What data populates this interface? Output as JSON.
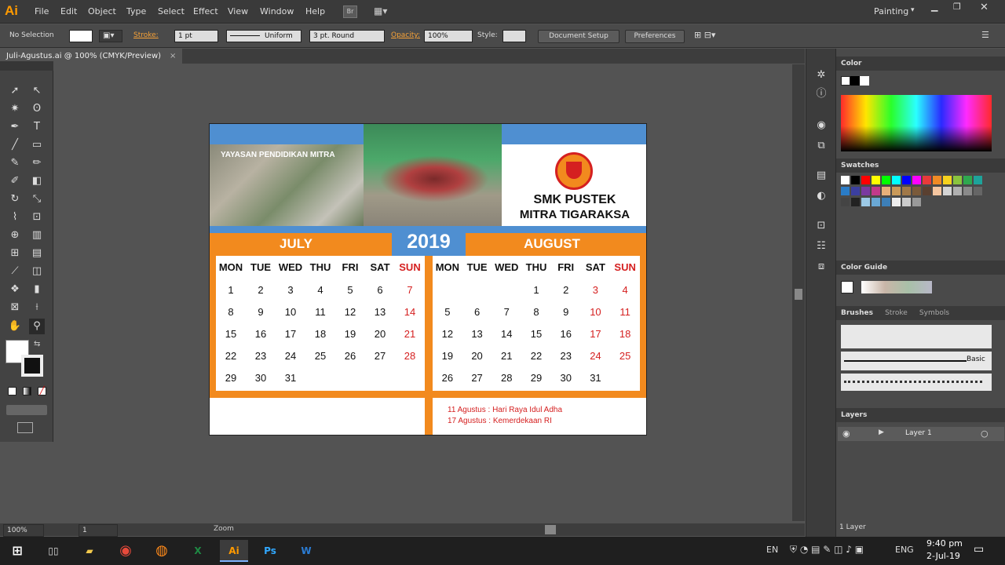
{
  "app": {
    "logo": "Ai",
    "workspace": "Painting"
  },
  "menu": [
    "File",
    "Edit",
    "Object",
    "Type",
    "Select",
    "Effect",
    "View",
    "Window",
    "Help"
  ],
  "control": {
    "selection": "No Selection",
    "stroke_label": "Stroke:",
    "stroke_value": "1 pt",
    "profile": "Uniform",
    "brush": "3 pt. Round",
    "opacity_label": "Opacity:",
    "opacity_value": "100%",
    "style_label": "Style:",
    "doc_setup": "Document Setup",
    "preferences": "Preferences"
  },
  "tab": {
    "title": "Juli-Agustus.ai @ 100% (CMYK/Preview)",
    "close": "×"
  },
  "status": {
    "zoom": "100%",
    "artboard": "1",
    "zoom_label": "Zoom"
  },
  "panels": {
    "color": "Color",
    "swatches": "Swatches",
    "color_guide": "Color Guide",
    "brushes": "Brushes",
    "stroke": "Stroke",
    "symbols": "Symbols",
    "brush_basic": "Basic",
    "layers": "Layers",
    "layer_name": "Layer 1",
    "layer_count": "1 Layer"
  },
  "calendar": {
    "banner_text": "YAYASAN PENDIDIKAN MITRA",
    "school_line1": "SMK PUSTEK",
    "school_line2": "MITRA TIGARAKSA",
    "year": "2019",
    "month_left": "JULY",
    "month_right": "AUGUST",
    "days": [
      "MON",
      "TUE",
      "WED",
      "THU",
      "FRI",
      "SAT",
      "SUN"
    ],
    "july": [
      [
        "1",
        "2",
        "3",
        "4",
        "5",
        "6",
        "7"
      ],
      [
        "8",
        "9",
        "10",
        "11",
        "12",
        "13",
        "14"
      ],
      [
        "15",
        "16",
        "17",
        "18",
        "19",
        "20",
        "21"
      ],
      [
        "22",
        "23",
        "24",
        "25",
        "26",
        "27",
        "28"
      ],
      [
        "29",
        "30",
        "31",
        "",
        "",
        "",
        ""
      ]
    ],
    "august": [
      [
        "",
        "",
        "",
        "1",
        "2",
        "3",
        "4"
      ],
      [
        "5",
        "6",
        "7",
        "8",
        "9",
        "10",
        "11"
      ],
      [
        "12",
        "13",
        "14",
        "15",
        "16",
        "17",
        "18"
      ],
      [
        "19",
        "20",
        "21",
        "22",
        "23",
        "24",
        "25"
      ],
      [
        "26",
        "27",
        "28",
        "29",
        "30",
        "31",
        ""
      ]
    ],
    "holidays": [
      "11 Agustus : Hari Raya Idul Adha",
      "17 Agustus : Kemerdekaan RI"
    ],
    "colors": {
      "orange": "#f28a1e",
      "blue": "#4f8fd1",
      "red": "#d52020"
    }
  },
  "taskbar": {
    "lang": "EN",
    "lang2": "ENG",
    "time": "9:40 pm",
    "date": "2-Jul-19"
  }
}
